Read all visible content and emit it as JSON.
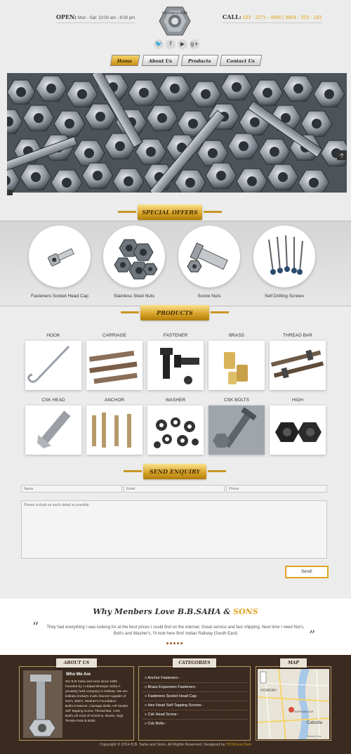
{
  "header": {
    "open_label": "OPEN:",
    "open_hours": "Mon - Sat: 10:00 am - 8:00 pm",
    "call_label": "CALL:",
    "call_numbers": "033 - 2271 - 4490 | 9804 - 325 - 183",
    "logo_text": "B.B.SAHA & SONS"
  },
  "social": {
    "twitter": "🐦",
    "facebook": "f",
    "youtube": "▶",
    "gplus": "g+"
  },
  "nav": {
    "home": "Home",
    "about": "About Us",
    "products": "Products",
    "contact": "Contact Us"
  },
  "hero": {
    "arrow": "🡡"
  },
  "sections": {
    "special_offers": "SPECIAL OFFERS",
    "products": "PRODUCTS",
    "send_enquiry": "SEND ENQUIRY"
  },
  "offers": [
    {
      "label": "Fasteners Socket Head Cap"
    },
    {
      "label": "Stainless Steel Nuts"
    },
    {
      "label": "Screw Nuts"
    },
    {
      "label": "Self Drilling Screws"
    }
  ],
  "products": [
    {
      "name": "HOOK"
    },
    {
      "name": "CARRIAGE"
    },
    {
      "name": "FASTENER"
    },
    {
      "name": "BRASS"
    },
    {
      "name": "THREAD BAR"
    },
    {
      "name": "CSK HEAD"
    },
    {
      "name": "ANCHOR"
    },
    {
      "name": "WASHER"
    },
    {
      "name": "CSK BOLTS"
    },
    {
      "name": "HIGH"
    }
  ],
  "enquiry": {
    "name_placeholder": "Name",
    "email_placeholder": "Email",
    "phone_placeholder": "Phone",
    "message_placeholder": "Please include as much detail as possible.",
    "send_label": "Send!"
  },
  "testimonial": {
    "title_main": "Why Menbers Love B.B.SAHA & ",
    "title_accent": "SONS",
    "open_quote": "“",
    "close_quote": "”",
    "text": "They had everything I was looking for at the best prices I could find on the internet. Great service and fast shipping. Next time I need Nut's, Bolt's and Washer's, I'll look here first! Indian Railway (South East)"
  },
  "footer": {
    "about_title": "ABOUT US",
    "categories_title": "CATEGORIES",
    "map_title": "MAP",
    "who_title": "Who We Are",
    "who_text": "We B.B.Saha and sons since 1960 founded by Lt.Bipad Bhanjan Saha A privately held company in kolkata. We are kolkata (India)'s multi channel supplier of Nut's, Bolt's, Washer's,Foundation Bolt's,Fastener, Carriage Bolts, HP Dealer self Tapping screw, Thread Bar, CSK Bolt's,All Kind of HOOK'S, Rivets, High Tensile Nuts & Bolts",
    "categories": [
      "» Anchor Fasteners -",
      "» Brass Expansion Fasteners -",
      "» Fasteners Socket Head Cap -",
      "» Hex Head Self-Tapping Screws -",
      "» Csk Head Screw -",
      "» Csk Bolts -"
    ],
    "map_labels": {
      "howrah": "HOWRAH",
      "calcutta": "Calcutta",
      "burrabazar": "BURRABAZAR",
      "terms": "Terms of Use"
    },
    "copyright_text": "Copyright © 2014 B.B. Saha and Sons. All Rights Reserved. Designed by ",
    "copyright_link": "ITCSLive.Com"
  },
  "colors": {
    "accent": "#e0a420",
    "footer_bg": "#3b2a1f",
    "page_bg": "#ececec"
  }
}
